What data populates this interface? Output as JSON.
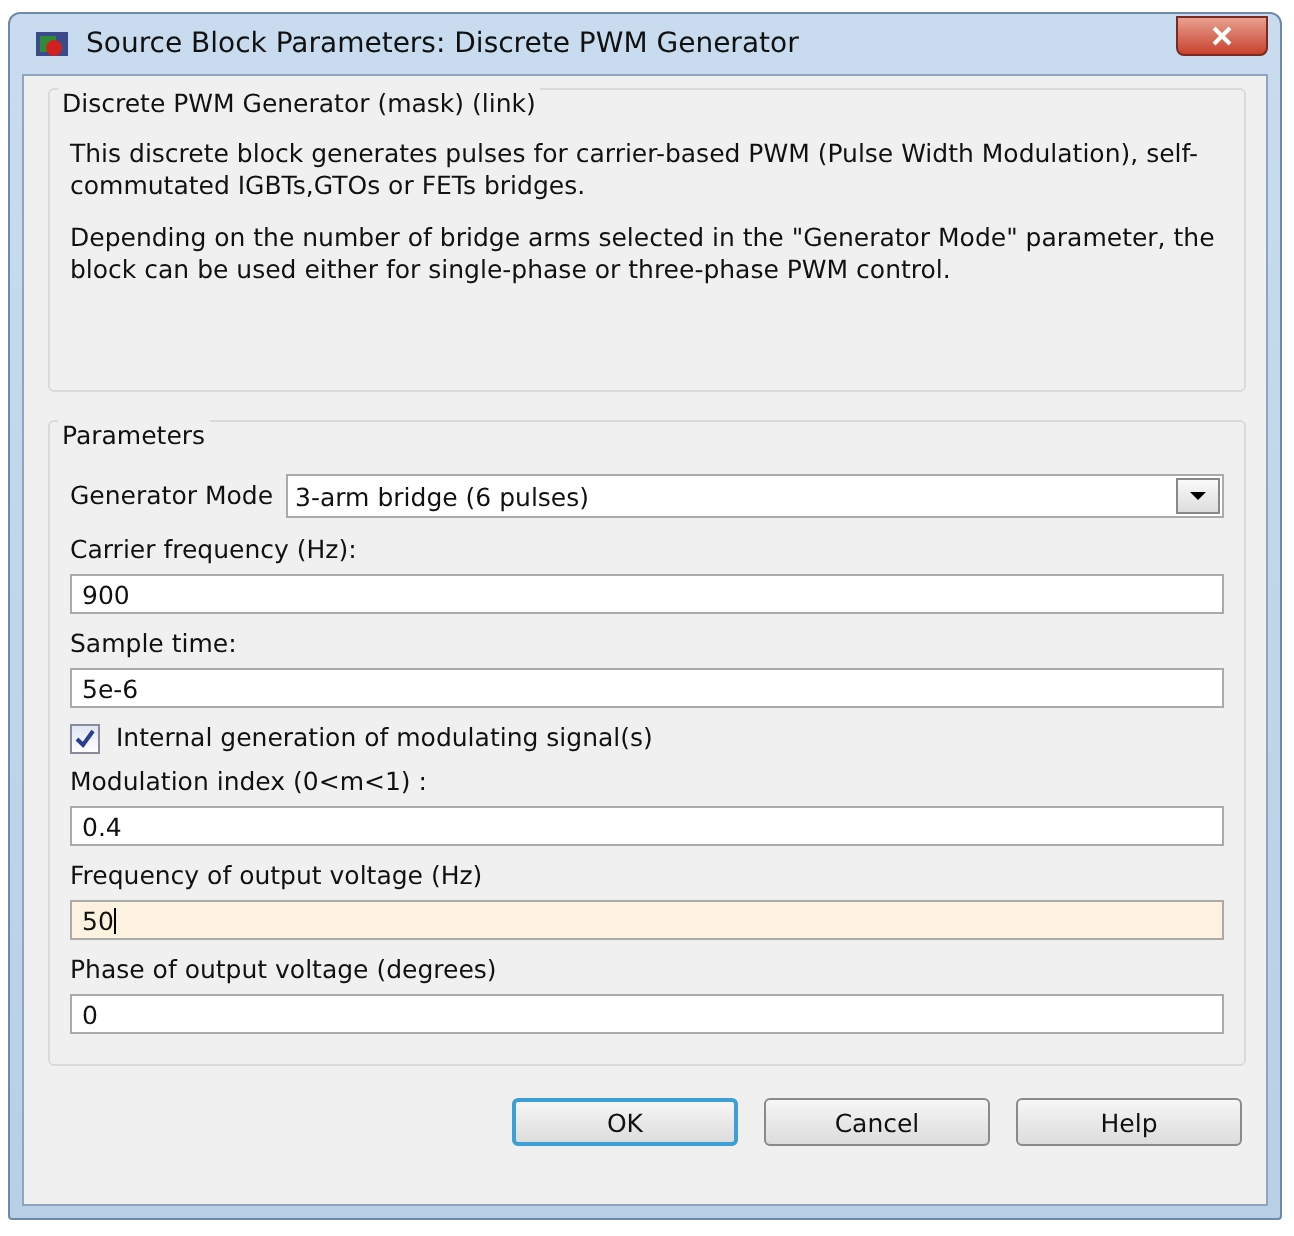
{
  "window": {
    "title": "Source Block Parameters: Discrete PWM Generator"
  },
  "description": {
    "title": "Discrete PWM Generator (mask) (link)",
    "paragraphs": [
      "This discrete block generates pulses for carrier-based PWM (Pulse Width Modulation), self-commutated IGBTs,GTOs or FETs bridges.",
      "Depending on the number of bridge arms selected in the \"Generator Mode\" parameter, the block can be used either for single-phase or three-phase PWM control."
    ]
  },
  "parameters": {
    "title": "Parameters",
    "items": [
      {
        "kind": "dropdown",
        "label": "Generator Mode",
        "value": "3-arm  bridge (6 pulses)"
      },
      {
        "kind": "text",
        "label": "Carrier frequency (Hz):",
        "value": "900",
        "focused": false
      },
      {
        "kind": "text",
        "label": "Sample time:",
        "value": "5e-6",
        "focused": false
      },
      {
        "kind": "checkbox",
        "label": "Internal generation of modulating signal(s)",
        "checked": true
      },
      {
        "kind": "text",
        "label": "Modulation index  (0<m<1) :",
        "value": "0.4",
        "focused": false
      },
      {
        "kind": "text",
        "label": "Frequency of output voltage (Hz)",
        "value": "50",
        "focused": true
      },
      {
        "kind": "text",
        "label": "Phase of output voltage (degrees)",
        "value": "0",
        "focused": false
      }
    ]
  },
  "buttons": [
    {
      "label": "OK",
      "default": true
    },
    {
      "label": "Cancel",
      "default": false
    },
    {
      "label": "Help",
      "default": false
    }
  ]
}
